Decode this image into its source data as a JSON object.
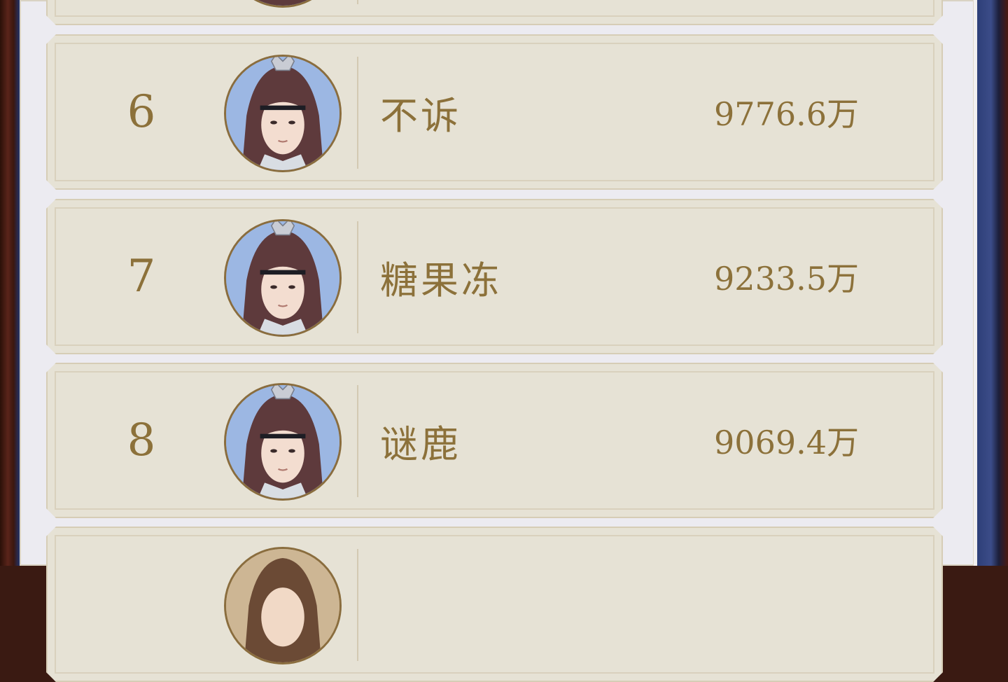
{
  "leaderboard": {
    "rows": [
      {
        "rank": "",
        "name": "",
        "score": "",
        "avatar_icon": "character-portrait-icon"
      },
      {
        "rank": "6",
        "name": "不诉",
        "score": "9776.6万",
        "avatar_icon": "character-portrait-icon"
      },
      {
        "rank": "7",
        "name": "糖果冻",
        "score": "9233.5万",
        "avatar_icon": "character-portrait-icon"
      },
      {
        "rank": "8",
        "name": "谜鹿",
        "score": "9069.4万",
        "avatar_icon": "character-portrait-icon"
      },
      {
        "rank": "",
        "name": "",
        "score": "",
        "avatar_icon": "character-portrait-icon"
      }
    ]
  },
  "colors": {
    "text_gold": "#8c713a",
    "row_bg": "#e6e2d5",
    "panel_bg": "#ecebf1"
  }
}
